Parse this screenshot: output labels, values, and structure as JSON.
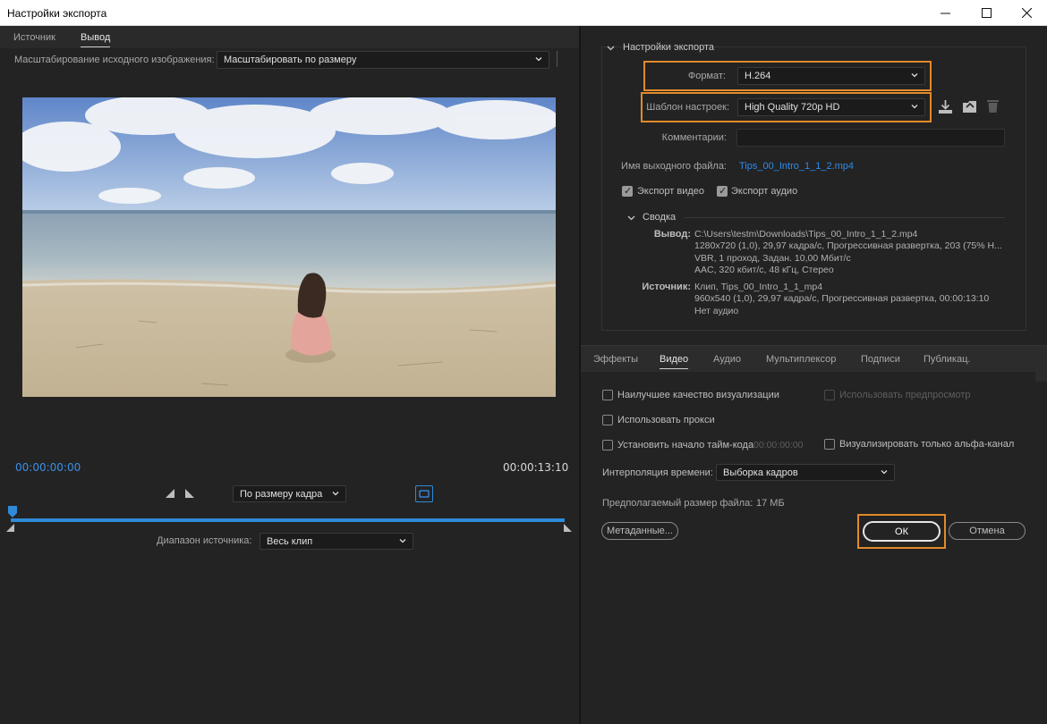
{
  "window": {
    "title": "Настройки экспорта"
  },
  "left": {
    "tabs": [
      {
        "label": "Источник"
      },
      {
        "label": "Вывод"
      }
    ],
    "scaling": {
      "label": "Масштабирование исходного изображения:",
      "value": "Масштабировать по размеру"
    },
    "timeline": {
      "start_time": "00:00:00:00",
      "end_time": "00:00:13:10",
      "fit_value": "По размеру кадра",
      "range_label": "Диапазон источника:",
      "range_value": "Весь клип"
    }
  },
  "right": {
    "section_title": "Настройки экспорта",
    "format": {
      "label": "Формат:",
      "value": "H.264"
    },
    "preset": {
      "label": "Шаблон настроек:",
      "value": "High Quality 720p HD"
    },
    "comments": {
      "label": "Комментарии:",
      "value": ""
    },
    "output_name": {
      "label": "Имя выходного файла:",
      "value": "Tips_00_Intro_1_1_2.mp4"
    },
    "export_video": {
      "label": "Экспорт видео",
      "checked": true
    },
    "export_audio": {
      "label": "Экспорт аудио",
      "checked": true
    },
    "summary": {
      "title": "Сводка",
      "output_label": "Вывод:",
      "output_lines": [
        "C:\\Users\\testm\\Downloads\\Tips_00_Intro_1_1_2.mp4",
        "1280x720 (1,0), 29,97 кадра/с, Прогрессивная развертка, 203 (75% Н...",
        "VBR, 1 проход, Задан. 10,00 Мбит/с",
        "AAC, 320 кбит/с, 48 кГц, Стерео"
      ],
      "source_label": "Источник:",
      "source_lines": [
        "Клип, Tips_00_Intro_1_1_mp4",
        "960x540 (1,0), 29,97 кадра/с, Прогрессивная развертка, 00:00:13:10",
        "Нет аудио"
      ]
    },
    "tabs": [
      {
        "label": "Эффекты"
      },
      {
        "label": "Видео"
      },
      {
        "label": "Аудио"
      },
      {
        "label": "Мультиплексор"
      },
      {
        "label": "Подписи"
      },
      {
        "label": "Публикац."
      }
    ],
    "options": {
      "max_render_quality": "Наилучшее качество визуализации",
      "use_previews": "Использовать предпросмотр",
      "use_proxies": "Использовать прокси",
      "set_start_timecode": "Установить начало тайм-кода",
      "start_timecode_value": "00:00:00:00",
      "render_alpha_only": "Визуализировать только альфа-канал",
      "time_interp_label": "Интерполяция времени:",
      "time_interp_value": "Выборка кадров",
      "file_size_label": "Предполагаемый размер файла:",
      "file_size_value": "17 МБ"
    },
    "buttons": {
      "metadata": "Метаданные...",
      "ok": "ОК",
      "cancel": "Отмена"
    }
  },
  "colors": {
    "accent_orange": "#e28a2a",
    "link_blue": "#2d8ceb",
    "timecode_blue": "#3b8fe6",
    "timeline_bar": "#2f8ad8"
  }
}
